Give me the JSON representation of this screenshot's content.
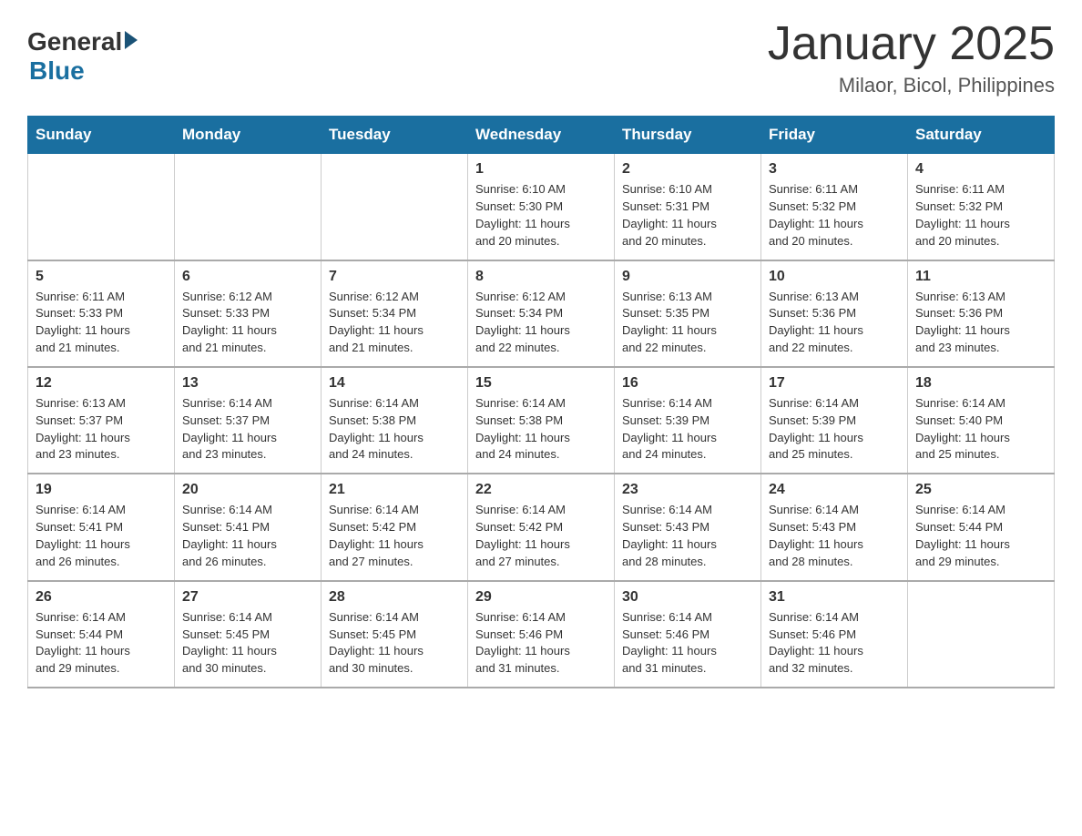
{
  "logo": {
    "general": "General",
    "blue": "Blue"
  },
  "title": "January 2025",
  "location": "Milaor, Bicol, Philippines",
  "weekdays": [
    "Sunday",
    "Monday",
    "Tuesday",
    "Wednesday",
    "Thursday",
    "Friday",
    "Saturday"
  ],
  "weeks": [
    [
      {
        "day": "",
        "info": ""
      },
      {
        "day": "",
        "info": ""
      },
      {
        "day": "",
        "info": ""
      },
      {
        "day": "1",
        "info": "Sunrise: 6:10 AM\nSunset: 5:30 PM\nDaylight: 11 hours\nand 20 minutes."
      },
      {
        "day": "2",
        "info": "Sunrise: 6:10 AM\nSunset: 5:31 PM\nDaylight: 11 hours\nand 20 minutes."
      },
      {
        "day": "3",
        "info": "Sunrise: 6:11 AM\nSunset: 5:32 PM\nDaylight: 11 hours\nand 20 minutes."
      },
      {
        "day": "4",
        "info": "Sunrise: 6:11 AM\nSunset: 5:32 PM\nDaylight: 11 hours\nand 20 minutes."
      }
    ],
    [
      {
        "day": "5",
        "info": "Sunrise: 6:11 AM\nSunset: 5:33 PM\nDaylight: 11 hours\nand 21 minutes."
      },
      {
        "day": "6",
        "info": "Sunrise: 6:12 AM\nSunset: 5:33 PM\nDaylight: 11 hours\nand 21 minutes."
      },
      {
        "day": "7",
        "info": "Sunrise: 6:12 AM\nSunset: 5:34 PM\nDaylight: 11 hours\nand 21 minutes."
      },
      {
        "day": "8",
        "info": "Sunrise: 6:12 AM\nSunset: 5:34 PM\nDaylight: 11 hours\nand 22 minutes."
      },
      {
        "day": "9",
        "info": "Sunrise: 6:13 AM\nSunset: 5:35 PM\nDaylight: 11 hours\nand 22 minutes."
      },
      {
        "day": "10",
        "info": "Sunrise: 6:13 AM\nSunset: 5:36 PM\nDaylight: 11 hours\nand 22 minutes."
      },
      {
        "day": "11",
        "info": "Sunrise: 6:13 AM\nSunset: 5:36 PM\nDaylight: 11 hours\nand 23 minutes."
      }
    ],
    [
      {
        "day": "12",
        "info": "Sunrise: 6:13 AM\nSunset: 5:37 PM\nDaylight: 11 hours\nand 23 minutes."
      },
      {
        "day": "13",
        "info": "Sunrise: 6:14 AM\nSunset: 5:37 PM\nDaylight: 11 hours\nand 23 minutes."
      },
      {
        "day": "14",
        "info": "Sunrise: 6:14 AM\nSunset: 5:38 PM\nDaylight: 11 hours\nand 24 minutes."
      },
      {
        "day": "15",
        "info": "Sunrise: 6:14 AM\nSunset: 5:38 PM\nDaylight: 11 hours\nand 24 minutes."
      },
      {
        "day": "16",
        "info": "Sunrise: 6:14 AM\nSunset: 5:39 PM\nDaylight: 11 hours\nand 24 minutes."
      },
      {
        "day": "17",
        "info": "Sunrise: 6:14 AM\nSunset: 5:39 PM\nDaylight: 11 hours\nand 25 minutes."
      },
      {
        "day": "18",
        "info": "Sunrise: 6:14 AM\nSunset: 5:40 PM\nDaylight: 11 hours\nand 25 minutes."
      }
    ],
    [
      {
        "day": "19",
        "info": "Sunrise: 6:14 AM\nSunset: 5:41 PM\nDaylight: 11 hours\nand 26 minutes."
      },
      {
        "day": "20",
        "info": "Sunrise: 6:14 AM\nSunset: 5:41 PM\nDaylight: 11 hours\nand 26 minutes."
      },
      {
        "day": "21",
        "info": "Sunrise: 6:14 AM\nSunset: 5:42 PM\nDaylight: 11 hours\nand 27 minutes."
      },
      {
        "day": "22",
        "info": "Sunrise: 6:14 AM\nSunset: 5:42 PM\nDaylight: 11 hours\nand 27 minutes."
      },
      {
        "day": "23",
        "info": "Sunrise: 6:14 AM\nSunset: 5:43 PM\nDaylight: 11 hours\nand 28 minutes."
      },
      {
        "day": "24",
        "info": "Sunrise: 6:14 AM\nSunset: 5:43 PM\nDaylight: 11 hours\nand 28 minutes."
      },
      {
        "day": "25",
        "info": "Sunrise: 6:14 AM\nSunset: 5:44 PM\nDaylight: 11 hours\nand 29 minutes."
      }
    ],
    [
      {
        "day": "26",
        "info": "Sunrise: 6:14 AM\nSunset: 5:44 PM\nDaylight: 11 hours\nand 29 minutes."
      },
      {
        "day": "27",
        "info": "Sunrise: 6:14 AM\nSunset: 5:45 PM\nDaylight: 11 hours\nand 30 minutes."
      },
      {
        "day": "28",
        "info": "Sunrise: 6:14 AM\nSunset: 5:45 PM\nDaylight: 11 hours\nand 30 minutes."
      },
      {
        "day": "29",
        "info": "Sunrise: 6:14 AM\nSunset: 5:46 PM\nDaylight: 11 hours\nand 31 minutes."
      },
      {
        "day": "30",
        "info": "Sunrise: 6:14 AM\nSunset: 5:46 PM\nDaylight: 11 hours\nand 31 minutes."
      },
      {
        "day": "31",
        "info": "Sunrise: 6:14 AM\nSunset: 5:46 PM\nDaylight: 11 hours\nand 32 minutes."
      },
      {
        "day": "",
        "info": ""
      }
    ]
  ]
}
